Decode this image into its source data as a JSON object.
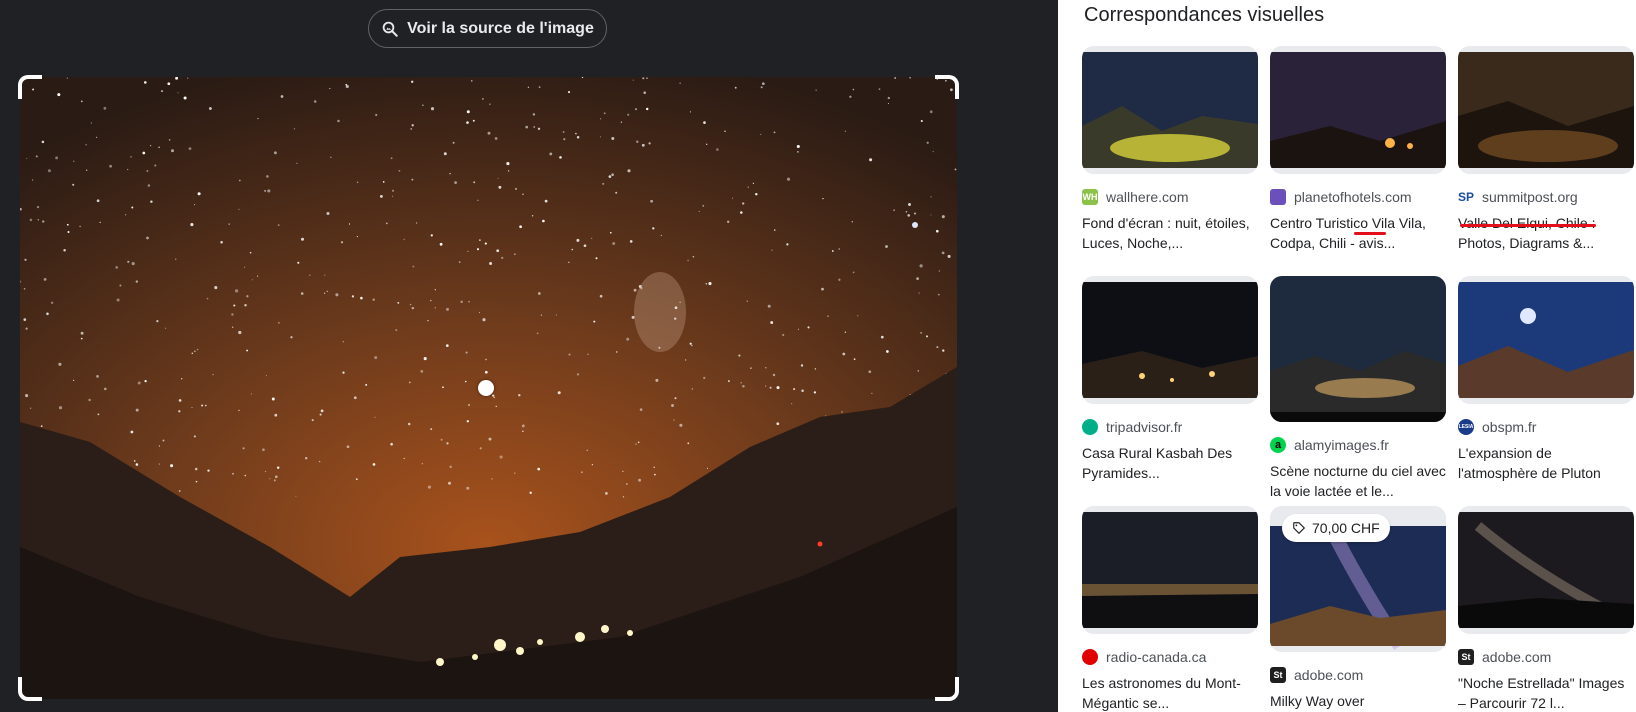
{
  "viewer": {
    "source_button_label": "Voir la source de l'image",
    "source_button_icon": "image-search-icon"
  },
  "results": {
    "title": "Correspondances visuelles",
    "cards": [
      {
        "source": "wallhere.com",
        "favicon_text": "WH",
        "favicon_color": "#8bc34a",
        "title": "Fond d'écran : nuit, étoiles, Luces, Noche,..."
      },
      {
        "source": "planetofhotels.com",
        "favicon_text": "",
        "favicon_color": "#6b4fbb",
        "title": "Centro Turistico Vila Vila, Codpa, Chili - avis..."
      },
      {
        "source": "summitpost.org",
        "favicon_text": "SP",
        "favicon_color": "#ffffff",
        "title": "Valle Del Elqui, Chile : Photos, Diagrams &..."
      },
      {
        "source": "tripadvisor.fr",
        "favicon_text": "",
        "favicon_color": "#00af87",
        "title": "Casa Rural Kasbah Des Pyramides..."
      },
      {
        "source": "alamyimages.fr",
        "favicon_text": "a",
        "favicon_color": "#00d34d",
        "title": "Scène nocturne du ciel avec la voie lactée et le..."
      },
      {
        "source": "obspm.fr",
        "favicon_text": "LESIA",
        "favicon_color": "#1a3a8a",
        "title": "L'expansion de l'atmosphère de Pluton"
      },
      {
        "source": "radio-canada.ca",
        "favicon_text": "",
        "favicon_color": "#e10000",
        "title": "Les astronomes du Mont-Mégantic se..."
      },
      {
        "source": "adobe.com",
        "favicon_text": "St",
        "favicon_color": "#1f1f1f",
        "title": "Milky Way over",
        "price": "70,00 CHF"
      },
      {
        "source": "adobe.com",
        "favicon_text": "St",
        "favicon_color": "#1f1f1f",
        "title": "\"Noche Estrellada\" Images – Parcourir 72 l..."
      }
    ]
  }
}
